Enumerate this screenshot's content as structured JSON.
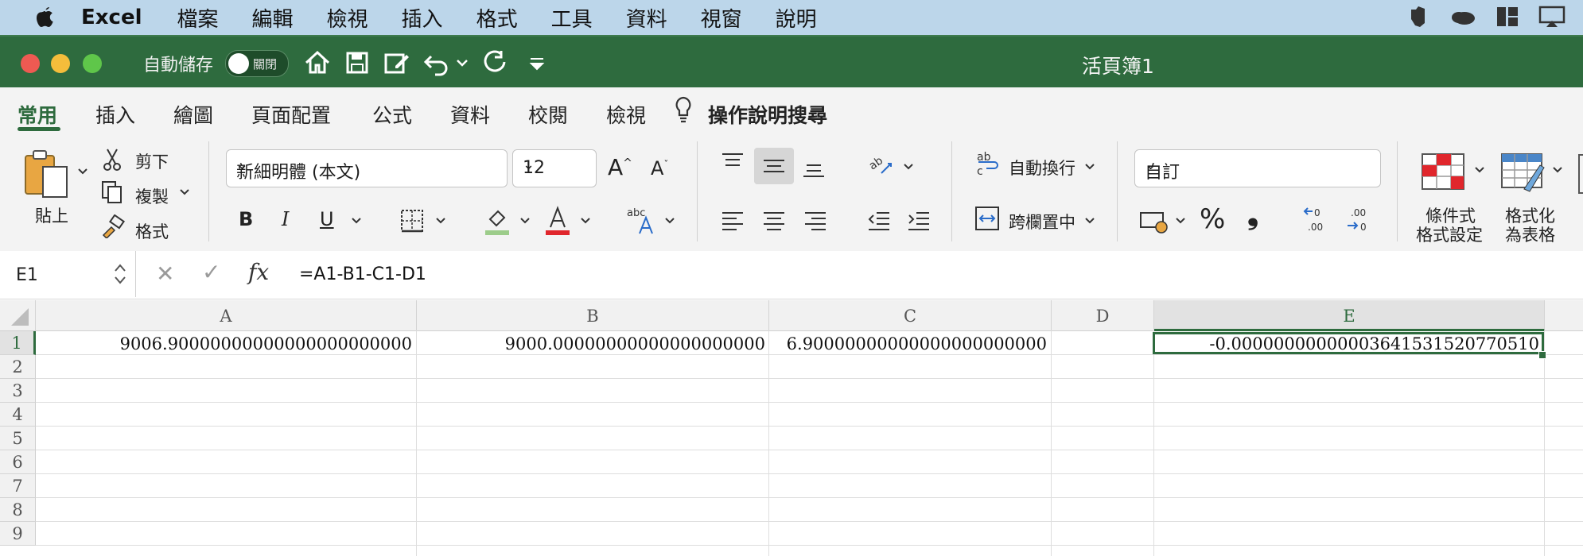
{
  "menubar": {
    "app_name": "Excel",
    "items": [
      "檔案",
      "編輯",
      "檢視",
      "插入",
      "格式",
      "工具",
      "資料",
      "視窗",
      "說明"
    ]
  },
  "titlebar": {
    "autosave_label": "自動儲存",
    "autosave_state": "關閉",
    "document_title": "活頁簿1"
  },
  "ribbon_tabs": [
    "常用",
    "插入",
    "繪圖",
    "頁面配置",
    "公式",
    "資料",
    "校閱",
    "檢視"
  ],
  "help_search": "操作說明搜尋",
  "clipboard": {
    "paste": "貼上",
    "cut": "剪下",
    "copy": "複製",
    "format_painter": "格式"
  },
  "font": {
    "name": "新細明體 (本文)",
    "size": "12",
    "bold": "B",
    "italic": "I",
    "underline": "U"
  },
  "alignment": {
    "wrap_text": "自動換行",
    "merge_center": "跨欄置中"
  },
  "number": {
    "format": "自訂",
    "percent": "%",
    "comma": "❟"
  },
  "styles": {
    "conditional_formatting": [
      "條件式",
      "格式設定"
    ],
    "format_as_table": [
      "格式化",
      "為表格"
    ]
  },
  "formula_bar": {
    "name_box": "E1",
    "fx": "fx",
    "formula": "=A1-B1-C1-D1"
  },
  "sheet": {
    "columns": [
      "A",
      "B",
      "C",
      "D",
      "E"
    ],
    "rows": [
      "1",
      "2",
      "3",
      "4",
      "5",
      "6",
      "7",
      "8",
      "9"
    ],
    "row1": {
      "A": "9006.90000000000000000000000",
      "B": "9000.00000000000000000000",
      "C": "6.90000000000000000000000",
      "D": "",
      "E": "-0.00000000000003641531520770510"
    },
    "selected_cell": "E1"
  },
  "colors": {
    "accent": "#2e6b3e",
    "menubar": "#bcd6ea",
    "ribbon": "#f3f3f3"
  }
}
